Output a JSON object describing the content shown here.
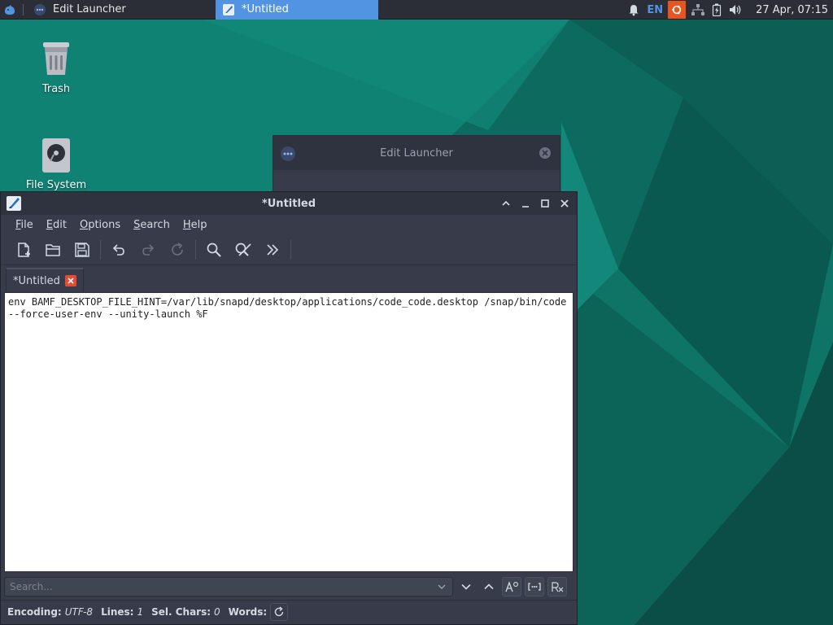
{
  "colors": {
    "accent": "#5294e2",
    "panel_bg": "#2b2e37",
    "window_bg": "#383c4a",
    "wallpaper": "#0d6c60",
    "tab_close": "#e54b35",
    "ubuntu_orange": "#e95420"
  },
  "panel": {
    "menu_icon": "xfce-mouse-icon",
    "tasks": [
      {
        "label": "Edit Launcher",
        "icon": "edit-launcher-icon",
        "active": false
      },
      {
        "label": "*Untitled",
        "icon": "mousepad-icon",
        "active": true
      }
    ],
    "tray": {
      "notifications_icon": "bell-icon",
      "lang": "EN",
      "updates_icon": "ubuntu-software-updater-icon",
      "network_icon": "network-icon",
      "battery_icon": "battery-icon",
      "volume_icon": "speaker-icon",
      "clock": "27 Apr, 07:15"
    }
  },
  "desktop": {
    "icons": [
      {
        "label": "Trash",
        "icon": "trash-icon"
      },
      {
        "label": "File System",
        "icon": "hard-drive-icon"
      }
    ]
  },
  "edit_launcher": {
    "title": "Edit Launcher"
  },
  "mousepad": {
    "title": "*Untitled",
    "menu": [
      {
        "label": "File",
        "accel": "F",
        "rest": "ile"
      },
      {
        "label": "Edit",
        "accel": "E",
        "rest": "dit"
      },
      {
        "label": "Options",
        "accel": "O",
        "rest": "ptions"
      },
      {
        "label": "Search",
        "accel": "S",
        "rest": "earch"
      },
      {
        "label": "Help",
        "accel": "H",
        "rest": "elp"
      }
    ],
    "toolbar": [
      "new-document-icon",
      "open-folder-icon",
      "save-icon",
      "undo-icon",
      "redo-icon",
      "revert-icon",
      "find-icon",
      "find-replace-icon",
      "more-arrows-icon"
    ],
    "tab_label": "*Untitled",
    "editor_lines": [
      "env BAMF_DESKTOP_FILE_HINT=/var/lib/snapd/desktop/applications/code_code.desktop /snap/bin/code",
      "--force-user-env --unity-launch %F"
    ],
    "search": {
      "placeholder": "Search..."
    },
    "status": {
      "encoding_label": "Encoding:",
      "encoding_value": "UTF-8",
      "lines_label": "Lines:",
      "lines_value": "1",
      "sel_label": "Sel. Chars:",
      "sel_value": "0",
      "words_label": "Words:"
    }
  }
}
